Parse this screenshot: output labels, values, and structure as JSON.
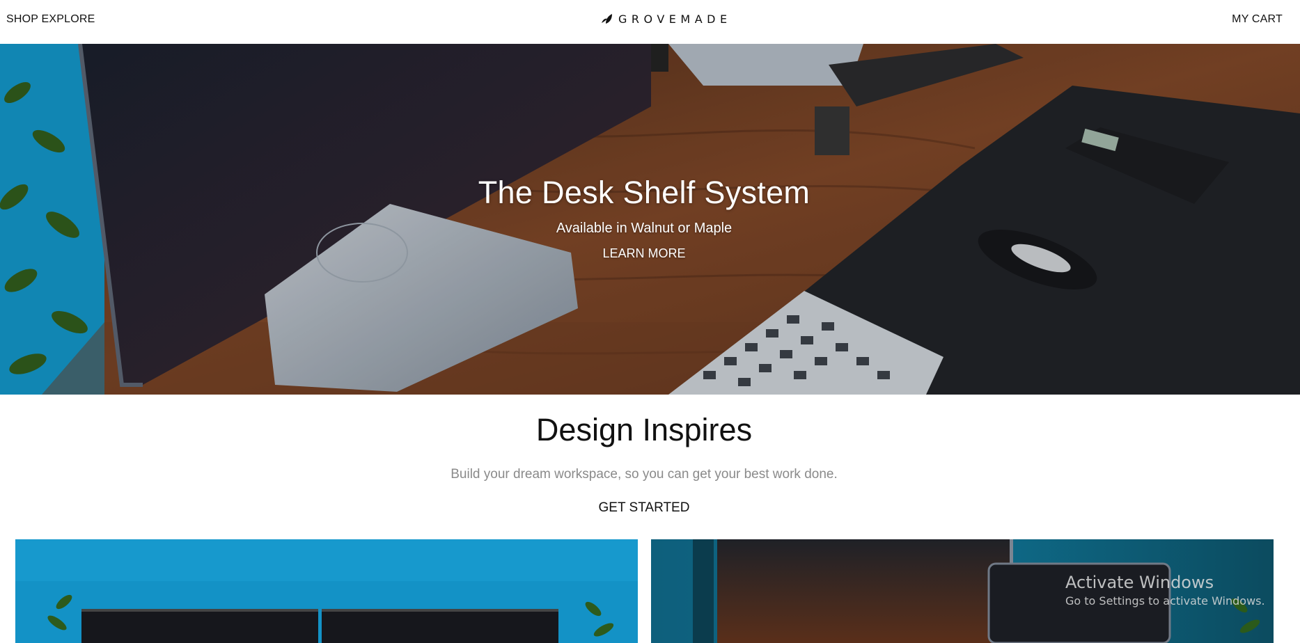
{
  "nav": {
    "shop_label": "SHOP",
    "explore_label": "EXPLORE",
    "brand": "GROVEMADE",
    "cart_label": "MY CART",
    "logo_icon": "leaf-logo-icon"
  },
  "hero": {
    "title": "The Desk Shelf System",
    "subtitle": "Available in Walnut or Maple",
    "cta_label": "LEARN MORE"
  },
  "intro": {
    "title": "Design Inspires",
    "subtitle": "Build your dream workspace, so you can get your best work done.",
    "cta_label": "GET STARTED"
  },
  "tiles": [
    {
      "name": "workspace-image-left"
    },
    {
      "name": "workspace-image-right"
    }
  ],
  "watermark": {
    "title": "Activate Windows",
    "subtitle": "Go to Settings to activate Windows."
  },
  "colors": {
    "text": "#111111",
    "muted": "#8a8a8a",
    "wood": "#6b3b22",
    "sky_blue": "#1492c6"
  }
}
